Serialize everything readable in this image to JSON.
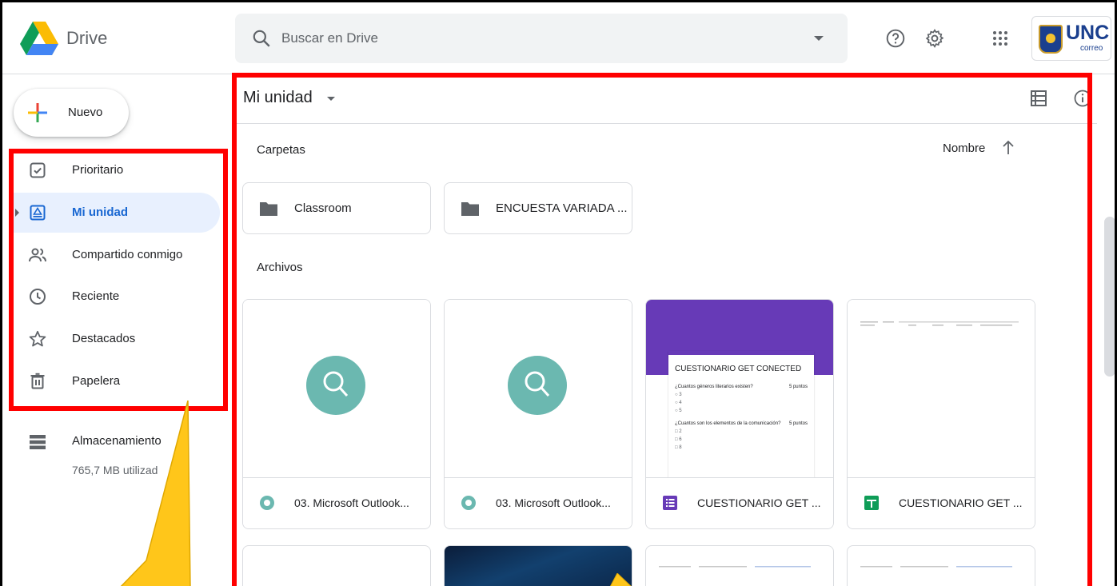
{
  "header": {
    "brand": "Drive",
    "search_placeholder": "Buscar en Drive",
    "account": {
      "name": "UNC",
      "subtitle": "correo"
    }
  },
  "sidebar": {
    "new_label": "Nuevo",
    "items": [
      {
        "label": "Prioritario",
        "icon": "priority-check-icon"
      },
      {
        "label": "Mi unidad",
        "icon": "my-drive-icon",
        "active": true
      },
      {
        "label": "Compartido conmigo",
        "icon": "shared-people-icon"
      },
      {
        "label": "Reciente",
        "icon": "clock-icon"
      },
      {
        "label": "Destacados",
        "icon": "star-icon"
      },
      {
        "label": "Papelera",
        "icon": "trash-icon"
      }
    ],
    "storage": {
      "label": "Almacenamiento",
      "used": "765,7 MB utilizad"
    }
  },
  "main": {
    "title": "Mi unidad",
    "folders_label": "Carpetas",
    "sort_label": "Nombre",
    "folders": [
      {
        "name": "Classroom"
      },
      {
        "name": "ENCUESTA VARIADA ..."
      }
    ],
    "files_label": "Archivos",
    "files": [
      {
        "name": "03. Microsoft Outlook...",
        "type": "video"
      },
      {
        "name": "03. Microsoft Outlook...",
        "type": "video"
      },
      {
        "name": "CUESTIONARIO GET ...",
        "type": "forms"
      },
      {
        "name": "CUESTIONARIO GET ...",
        "type": "sheets"
      }
    ],
    "forms_preview": {
      "title": "CUESTIONARIO GET CONECTED",
      "q1": "¿Cuantos géneros literarios existen?",
      "q1_points": "5 puntos",
      "q1_options": [
        "3",
        "4",
        "5"
      ],
      "q2": "¿Cuantos son los elementos de la comunicación?",
      "q2_points": "5 puntos",
      "q2_options": [
        "2",
        "6",
        "8"
      ]
    }
  },
  "colors": {
    "highlight": "#ff0000",
    "callout": "#ffc61a",
    "active_nav_bg": "#e8f0fe",
    "active_nav_text": "#1967d2",
    "forms_purple": "#673ab7",
    "video_teal": "#6bb8b0",
    "sheets_green": "#0f9d58"
  }
}
